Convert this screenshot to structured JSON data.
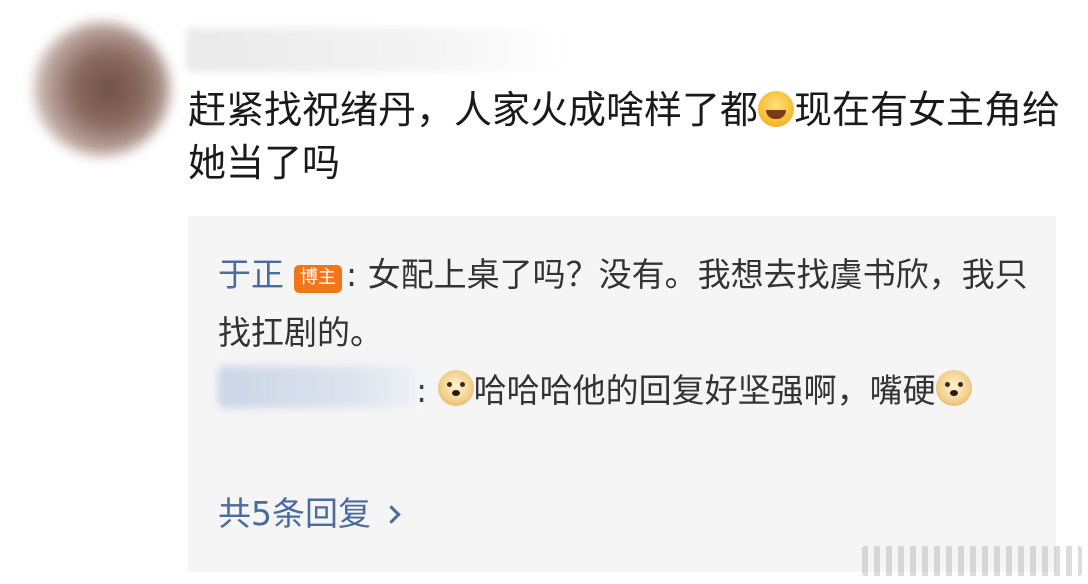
{
  "comment": {
    "text_before_emoji": "赶紧找祝绪丹，人家火成啥样了都",
    "emoji_1": "laugh-cry-icon",
    "text_after_emoji": "现在有女主角给她当了吗"
  },
  "replies": [
    {
      "author": "于正",
      "badge": "博主",
      "separator": ":",
      "text": "女配上桌了吗？没有。我想去找虞书欣，我只找扛剧的。"
    },
    {
      "author_hidden": true,
      "separator": ":",
      "emoji_before": "doge-icon",
      "text": "哈哈哈他的回复好坚强啊，嘴硬",
      "emoji_after": "doge-icon"
    }
  ],
  "more_replies_label": "共5条回复",
  "colors": {
    "link_blue": "#4a6b9e",
    "badge_orange": "#f0761a",
    "reply_background": "#f5f5f5"
  }
}
